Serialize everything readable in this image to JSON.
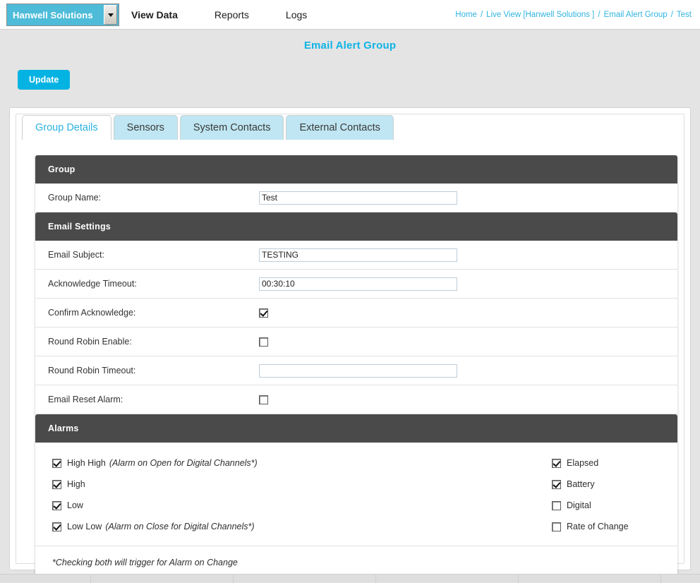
{
  "topbar": {
    "site_selector": {
      "value": "Hanwell Solutions",
      "icon": "chevron-down-icon"
    },
    "nav": [
      {
        "label": "View Data",
        "active": true
      },
      {
        "label": "Reports",
        "active": false
      },
      {
        "label": "Logs",
        "active": false
      }
    ],
    "breadcrumb": {
      "items": [
        "Home",
        "Live View [Hanwell Solutions ]",
        "Email Alert Group"
      ],
      "current": "Test",
      "separator": "/"
    }
  },
  "page": {
    "title": "Email Alert Group",
    "update_button": "Update",
    "title_color": "#0fb4e5",
    "accent_color": "#05b3e2"
  },
  "tabs": [
    {
      "label": "Group Details",
      "active": true
    },
    {
      "label": "Sensors",
      "active": false
    },
    {
      "label": "System Contacts",
      "active": false
    },
    {
      "label": "External Contacts",
      "active": false
    }
  ],
  "sections": {
    "group": {
      "heading": "Group",
      "fields": [
        {
          "label": "Group Name:",
          "value": "Test",
          "placeholder": ""
        }
      ]
    },
    "email_settings": {
      "heading": "Email Settings",
      "fields": [
        {
          "label": "Email Subject:",
          "value": "TESTING",
          "placeholder": ""
        },
        {
          "label": "Acknowledge Timeout:",
          "value": "00:30:10",
          "placeholder": ""
        },
        {
          "label": "Round Robin Timeout:",
          "value": "",
          "placeholder": ""
        }
      ],
      "checkboxes": [
        {
          "label": "Confirm Acknowledge:",
          "checked": true
        },
        {
          "label": "Round Robin Enable:",
          "checked": false
        },
        {
          "label": "Email Reset Alarm:",
          "checked": false
        }
      ]
    },
    "alarms": {
      "heading": "Alarms",
      "left": [
        {
          "label": "High High",
          "note": "(Alarm on Open for Digital Channels*)",
          "checked": true
        },
        {
          "label": "High",
          "note": "",
          "checked": true
        },
        {
          "label": "Low",
          "note": "",
          "checked": true
        },
        {
          "label": "Low Low",
          "note": "(Alarm on Close for Digital Channels*)",
          "checked": true
        }
      ],
      "right": [
        {
          "label": "Elapsed",
          "checked": true
        },
        {
          "label": "Battery",
          "checked": true
        },
        {
          "label": "Digital",
          "checked": false
        },
        {
          "label": "Rate of Change",
          "checked": false
        }
      ],
      "footnote": "*Checking both will trigger for Alarm on Change"
    }
  }
}
